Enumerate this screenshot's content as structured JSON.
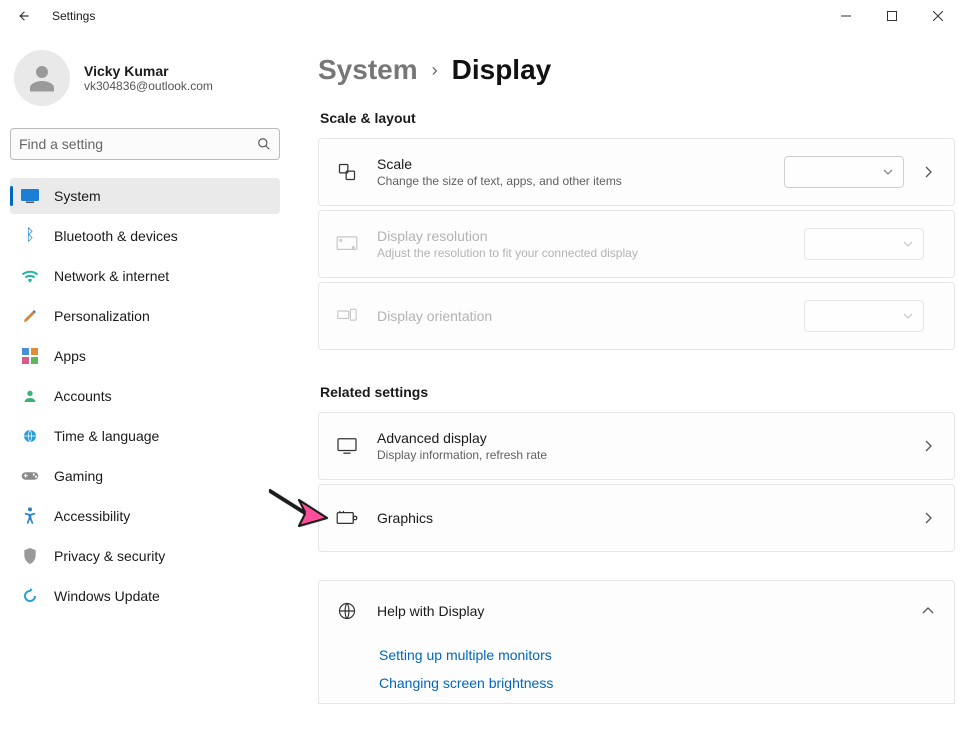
{
  "window": {
    "title": "Settings"
  },
  "user": {
    "name": "Vicky Kumar",
    "email": "vk304836@outlook.com"
  },
  "search": {
    "placeholder": "Find a setting"
  },
  "sidebar": {
    "items": [
      {
        "label": "System",
        "icon": "system",
        "active": true
      },
      {
        "label": "Bluetooth & devices",
        "icon": "bluetooth",
        "active": false
      },
      {
        "label": "Network & internet",
        "icon": "network",
        "active": false
      },
      {
        "label": "Personalization",
        "icon": "personalization",
        "active": false
      },
      {
        "label": "Apps",
        "icon": "apps",
        "active": false
      },
      {
        "label": "Accounts",
        "icon": "accounts",
        "active": false
      },
      {
        "label": "Time & language",
        "icon": "time",
        "active": false
      },
      {
        "label": "Gaming",
        "icon": "gaming",
        "active": false
      },
      {
        "label": "Accessibility",
        "icon": "accessibility",
        "active": false
      },
      {
        "label": "Privacy & security",
        "icon": "privacy",
        "active": false
      },
      {
        "label": "Windows Update",
        "icon": "update",
        "active": false
      }
    ]
  },
  "breadcrumb": {
    "parent": "System",
    "current": "Display"
  },
  "sections": {
    "scale_layout": {
      "heading": "Scale & layout",
      "scale": {
        "title": "Scale",
        "sub": "Change the size of text, apps, and other items"
      },
      "resolution": {
        "title": "Display resolution",
        "sub": "Adjust the resolution to fit your connected display"
      },
      "orientation": {
        "title": "Display orientation"
      }
    },
    "related": {
      "heading": "Related settings",
      "advanced": {
        "title": "Advanced display",
        "sub": "Display information, refresh rate"
      },
      "graphics": {
        "title": "Graphics"
      }
    },
    "help": {
      "heading": "Help with Display",
      "links": [
        "Setting up multiple monitors",
        "Changing screen brightness"
      ]
    }
  },
  "colors": {
    "accent": "#0067c0",
    "link": "#0067c0"
  },
  "annotation": {
    "arrow_target": "graphics-row",
    "arrow_color": "#ff4f9a"
  }
}
